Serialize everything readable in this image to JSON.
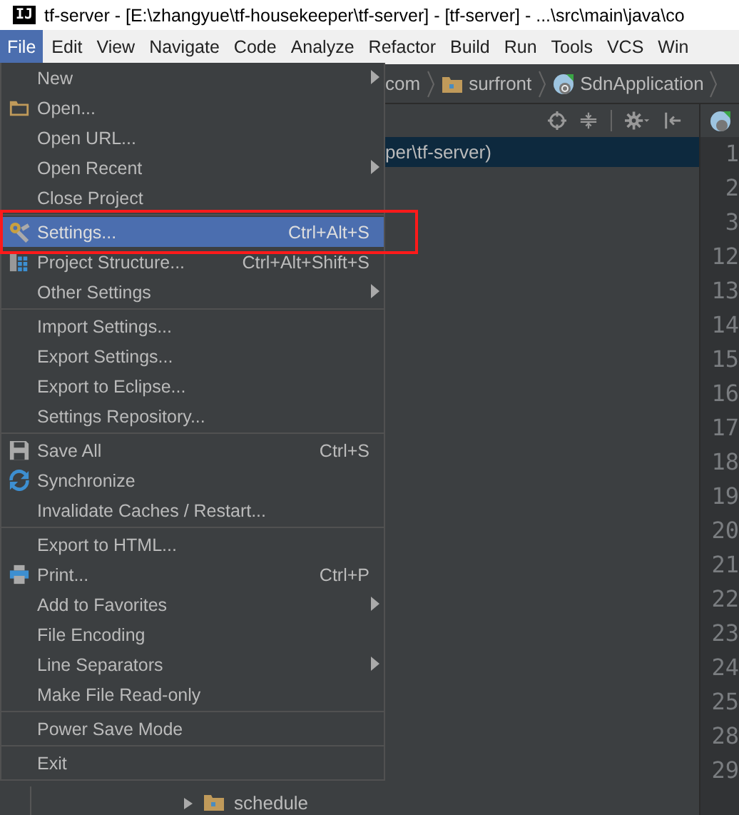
{
  "window": {
    "logo": "IJ",
    "title": "tf-server - [E:\\zhangyue\\tf-housekeeper\\tf-server] - [tf-server] - ...\\src\\main\\java\\co"
  },
  "menubar": [
    {
      "label": "File",
      "selected": true
    },
    {
      "label": "Edit",
      "selected": false
    },
    {
      "label": "View",
      "selected": false
    },
    {
      "label": "Navigate",
      "selected": false
    },
    {
      "label": "Code",
      "selected": false
    },
    {
      "label": "Analyze",
      "selected": false
    },
    {
      "label": "Refactor",
      "selected": false
    },
    {
      "label": "Build",
      "selected": false
    },
    {
      "label": "Run",
      "selected": false
    },
    {
      "label": "Tools",
      "selected": false
    },
    {
      "label": "VCS",
      "selected": false
    },
    {
      "label": "Win",
      "selected": false
    }
  ],
  "breadcrumbs": [
    {
      "label": "com",
      "kind": "package"
    },
    {
      "label": "surfront",
      "kind": "folder"
    },
    {
      "label": "SdnApplication",
      "kind": "class"
    }
  ],
  "project_tree": {
    "selected_row": "per\\tf-server)",
    "bottom_row": "schedule"
  },
  "line_numbers": [
    "1",
    "2",
    "3",
    "12",
    "13",
    "14",
    "15",
    "16",
    "17",
    "18",
    "19",
    "20",
    "21",
    "22",
    "23",
    "24",
    "25",
    "28",
    "29"
  ],
  "file_menu": {
    "groups": [
      [
        {
          "label": "New",
          "kind": "plain",
          "submenu": true,
          "selected": false,
          "circled": false
        },
        {
          "label": "Open...",
          "kind": "open",
          "submenu": false,
          "selected": false,
          "circled": false
        },
        {
          "label": "Open URL...",
          "kind": "plain",
          "submenu": false,
          "selected": false,
          "circled": false
        },
        {
          "label": "Open Recent",
          "kind": "plain",
          "submenu": true,
          "selected": false,
          "circled": false
        },
        {
          "label": "Close Project",
          "kind": "plain",
          "submenu": false,
          "selected": false,
          "circled": false
        }
      ],
      [
        {
          "label": "Settings...",
          "kind": "settings",
          "shortcut": "Ctrl+Alt+S",
          "submenu": false,
          "selected": true,
          "circled": true
        },
        {
          "label": "Project Structure...",
          "kind": "structure",
          "shortcut": "Ctrl+Alt+Shift+S",
          "submenu": false,
          "selected": false,
          "circled": false
        },
        {
          "label": "Other Settings",
          "kind": "plain",
          "submenu": true,
          "selected": false,
          "circled": false
        }
      ],
      [
        {
          "label": "Import Settings...",
          "kind": "plain",
          "submenu": false,
          "selected": false,
          "circled": false
        },
        {
          "label": "Export Settings...",
          "kind": "plain",
          "submenu": false,
          "selected": false,
          "circled": false
        },
        {
          "label": "Export to Eclipse...",
          "kind": "plain",
          "submenu": false,
          "selected": false,
          "circled": false
        },
        {
          "label": "Settings Repository...",
          "kind": "plain",
          "submenu": false,
          "selected": false,
          "circled": false
        }
      ],
      [
        {
          "label": "Save All",
          "kind": "save",
          "shortcut": "Ctrl+S",
          "submenu": false,
          "selected": false,
          "circled": false
        },
        {
          "label": "Synchronize",
          "kind": "sync",
          "submenu": false,
          "selected": false,
          "circled": false
        },
        {
          "label": "Invalidate Caches / Restart...",
          "kind": "plain",
          "submenu": false,
          "selected": false,
          "circled": false
        }
      ],
      [
        {
          "label": "Export to HTML...",
          "kind": "plain",
          "submenu": false,
          "selected": false,
          "circled": false
        },
        {
          "label": "Print...",
          "kind": "print",
          "shortcut": "Ctrl+P",
          "submenu": false,
          "selected": false,
          "circled": false
        },
        {
          "label": "Add to Favorites",
          "kind": "plain",
          "submenu": true,
          "selected": false,
          "circled": false
        },
        {
          "label": "File Encoding",
          "kind": "plain",
          "submenu": false,
          "selected": false,
          "circled": false
        },
        {
          "label": "Line Separators",
          "kind": "plain",
          "submenu": true,
          "selected": false,
          "circled": false
        },
        {
          "label": "Make File Read-only",
          "kind": "plain",
          "submenu": false,
          "selected": false,
          "circled": false
        }
      ],
      [
        {
          "label": "Power Save Mode",
          "kind": "plain",
          "submenu": false,
          "selected": false,
          "circled": false
        }
      ],
      [
        {
          "label": "Exit",
          "kind": "plain",
          "submenu": false,
          "selected": false,
          "circled": false
        }
      ]
    ]
  }
}
